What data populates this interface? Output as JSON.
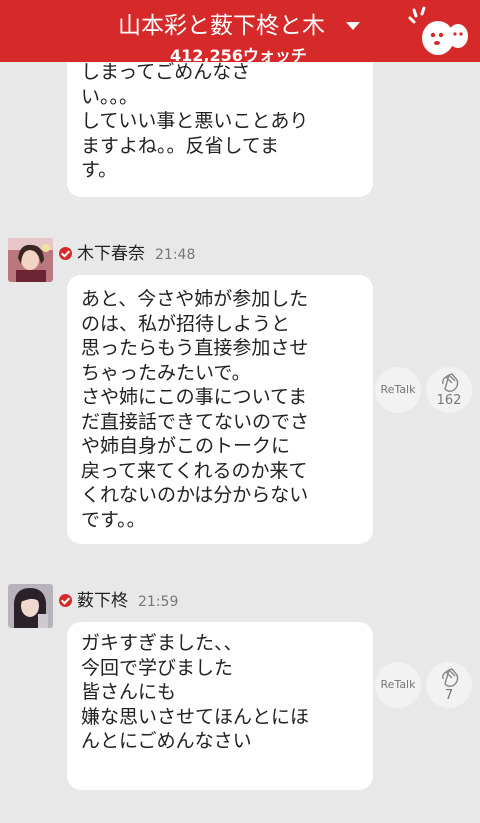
{
  "header": {
    "title": "山本彩と薮下柊と木",
    "watch_count": "412,256ウォッチ"
  },
  "messages": [
    {
      "lines": [
        "しまってごめんなさ",
        "い。。。",
        "していい事と悪いことあり",
        "ますよね。。反省してま",
        "す。"
      ]
    },
    {
      "sender": "木下春奈",
      "time": "21:48",
      "lines": [
        "あと、今さや姉が参加した",
        "のは、私が招待しようと",
        "思ったらもう直接参加させ",
        "ちゃったみたいで。",
        "さや姉にこの事についてま",
        "だ直接話できてないのでさ",
        "や姉自身がこのトークに",
        "戻って来てくれるのか来て",
        "くれないのかは分からない",
        "です。。"
      ],
      "retalk": "ReTalk",
      "claps": "162"
    },
    {
      "sender": "薮下柊",
      "time": "21:59",
      "lines": [
        "ガキすぎました、、",
        "今回で学びました",
        "皆さんにも",
        "嫌な思いさせてほんとにほ",
        "んとにごめんなさい"
      ],
      "retalk": "ReTalk",
      "claps": "7"
    }
  ],
  "colors": {
    "header": "#d62a2a",
    "background": "#e8e8e8",
    "bubble": "#ffffff"
  }
}
